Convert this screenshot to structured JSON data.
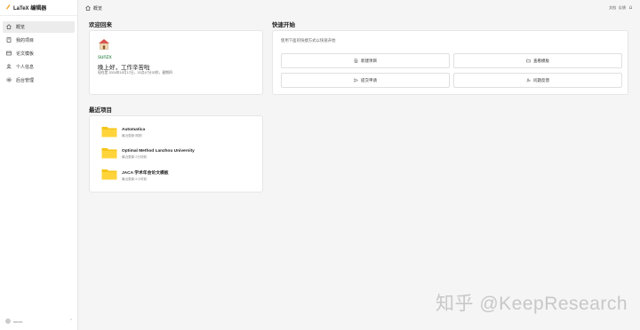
{
  "app": {
    "title": "LaTeX 编辑器"
  },
  "sidebar": {
    "items": [
      {
        "label": "概览",
        "icon": "home-icon",
        "active": true
      },
      {
        "label": "我的项目",
        "icon": "book-icon",
        "active": false
      },
      {
        "label": "论文模板",
        "icon": "template-icon",
        "active": false
      },
      {
        "label": "个人信息",
        "icon": "user-icon",
        "active": false
      },
      {
        "label": "后台管理",
        "icon": "gear-icon",
        "active": false
      }
    ],
    "footer": {
      "user": "sunzx"
    }
  },
  "header": {
    "breadcrumb": "概览",
    "right": {
      "link1": "文档",
      "link2": "反馈"
    }
  },
  "welcome": {
    "title": "欢迎回来",
    "username": "sunzx",
    "greeting": "晚上好，工作辛苦啦",
    "meta": "现在是 2024年10月17日，20点47分32秒，星期四"
  },
  "quickstart": {
    "title": "快速开始",
    "description": "使用下面的快捷方式以快速开始",
    "buttons": [
      {
        "label": "新建项目",
        "icon": "file-plus-icon"
      },
      {
        "label": "查看模板",
        "icon": "folder-open-icon"
      },
      {
        "label": "提交申请",
        "icon": "send-icon"
      },
      {
        "label": "问题反馈",
        "icon": "user-help-icon"
      }
    ]
  },
  "recent": {
    "title": "最近项目",
    "projects": [
      {
        "name": "Automatica",
        "time": "最近更新:刚刚"
      },
      {
        "name": "Optimal Method Lanzhou University",
        "time": "最近更新:2分钟前"
      },
      {
        "name": "JACA 学术年会论文模板",
        "time": "最近更新:2小时前"
      }
    ]
  },
  "colors": {
    "accent_green": "#1f7a3a",
    "folder": "#f5c518"
  },
  "watermark": "知乎 @KeepResearch"
}
